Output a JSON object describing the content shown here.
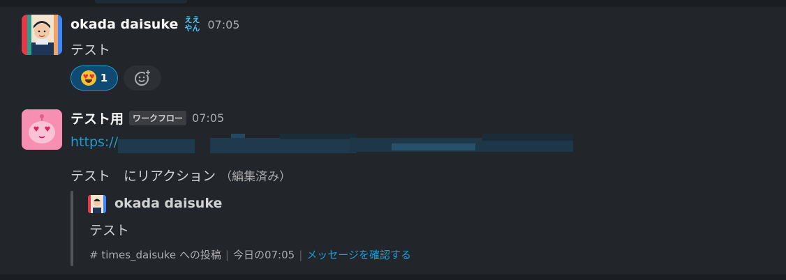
{
  "messages": [
    {
      "author": "okada daisuke",
      "status_emoji_text": [
        "ええ",
        "やん"
      ],
      "time": "07:05",
      "text": "テスト",
      "reactions": [
        {
          "emoji": "heart-eyes",
          "count": "1"
        }
      ]
    },
    {
      "author": "テスト用",
      "badge": "ワークフロー",
      "time": "07:05",
      "link_prefix": "https://",
      "reaction_notice": "テスト　にリアクション",
      "edited_label": "（編集済み）",
      "quote": {
        "author": "okada daisuke",
        "text": "テスト",
        "channel": "# times_daisuke への投稿",
        "timestamp": "今日の07:05",
        "view_link": "メッセージを確認する"
      }
    }
  ],
  "colors": {
    "link": "#1d9bd1",
    "reaction_bg": "#0f4a73",
    "background": "#222529"
  }
}
